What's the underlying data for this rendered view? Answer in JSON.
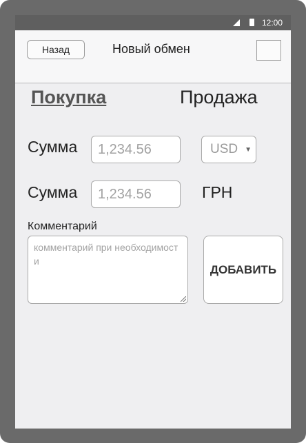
{
  "status_bar": {
    "time": "12:00"
  },
  "navbar": {
    "back_label": "Назад",
    "title": "Новый обмен"
  },
  "tabs": {
    "buy": "Покупка",
    "sell": "Продажа"
  },
  "amount_row_1": {
    "label": "Сумма",
    "placeholder": "1,234.56",
    "currency_selected": "USD"
  },
  "amount_row_2": {
    "label": "Сумма",
    "placeholder": "1,234.56",
    "currency": "ГРН"
  },
  "comment": {
    "label": "Комментарий",
    "placeholder": "комментарий при необходимости"
  },
  "add_button": {
    "label": "ДОБАВИТЬ"
  }
}
